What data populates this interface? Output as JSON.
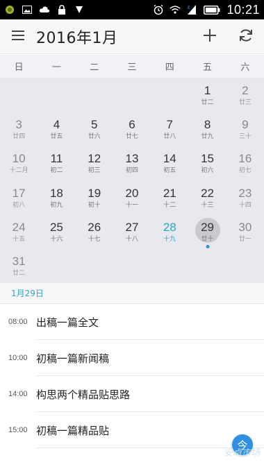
{
  "status_bar": {
    "time": "10:21",
    "icons_left": [
      "app-notification-icon",
      "image-icon",
      "cloud-icon",
      "lock-icon",
      "download-icon"
    ],
    "icons_right": [
      "alarm-icon",
      "wifi-icon",
      "signal-icon",
      "battery-icon"
    ]
  },
  "header": {
    "title": "2016年1月",
    "icons": [
      "menu-icon",
      "add-icon",
      "refresh-icon"
    ]
  },
  "weekdays": [
    "日",
    "一",
    "二",
    "三",
    "四",
    "五",
    "六"
  ],
  "calendar": {
    "days": [
      {
        "num": "",
        "lunar": ""
      },
      {
        "num": "",
        "lunar": ""
      },
      {
        "num": "",
        "lunar": ""
      },
      {
        "num": "",
        "lunar": ""
      },
      {
        "num": "",
        "lunar": ""
      },
      {
        "num": "1",
        "lunar": "廿二"
      },
      {
        "num": "2",
        "lunar": "廿三"
      },
      {
        "num": "3",
        "lunar": "廿四"
      },
      {
        "num": "4",
        "lunar": "廿五"
      },
      {
        "num": "5",
        "lunar": "廿六"
      },
      {
        "num": "6",
        "lunar": "廿七"
      },
      {
        "num": "7",
        "lunar": "廿八"
      },
      {
        "num": "8",
        "lunar": "廿九"
      },
      {
        "num": "9",
        "lunar": "三十"
      },
      {
        "num": "10",
        "lunar": "十二月"
      },
      {
        "num": "11",
        "lunar": "初二"
      },
      {
        "num": "12",
        "lunar": "初三"
      },
      {
        "num": "13",
        "lunar": "初四"
      },
      {
        "num": "14",
        "lunar": "初五"
      },
      {
        "num": "15",
        "lunar": "初六"
      },
      {
        "num": "16",
        "lunar": "初七"
      },
      {
        "num": "17",
        "lunar": "初八"
      },
      {
        "num": "18",
        "lunar": "初九"
      },
      {
        "num": "19",
        "lunar": "初十"
      },
      {
        "num": "20",
        "lunar": "十一"
      },
      {
        "num": "21",
        "lunar": "十二"
      },
      {
        "num": "22",
        "lunar": "十三"
      },
      {
        "num": "23",
        "lunar": "十四"
      },
      {
        "num": "24",
        "lunar": "十五"
      },
      {
        "num": "25",
        "lunar": "十六"
      },
      {
        "num": "26",
        "lunar": "十七"
      },
      {
        "num": "27",
        "lunar": "十八"
      },
      {
        "num": "28",
        "lunar": "十九"
      },
      {
        "num": "29",
        "lunar": "廿十"
      },
      {
        "num": "30",
        "lunar": "廿一"
      },
      {
        "num": "31",
        "lunar": "廿二"
      },
      {
        "num": "",
        "lunar": ""
      },
      {
        "num": "",
        "lunar": ""
      },
      {
        "num": "",
        "lunar": ""
      },
      {
        "num": "",
        "lunar": ""
      },
      {
        "num": "",
        "lunar": ""
      },
      {
        "num": "",
        "lunar": ""
      }
    ],
    "today": "28",
    "selected": "29",
    "accent_color": "#28a5c8",
    "dot_color": "#2f8fe0"
  },
  "selected_date_label": "1月29日",
  "events": [
    {
      "time": "08:00",
      "title": "出稿一篇全文"
    },
    {
      "time": "10:00",
      "title": "初稿一篇新闻稿"
    },
    {
      "time": "14:00",
      "title": "构思两个精品贴思路"
    },
    {
      "time": "15:00",
      "title": "初稿一篇精品贴"
    }
  ],
  "fab": {
    "label": "今"
  },
  "watermark": "安卓市场"
}
